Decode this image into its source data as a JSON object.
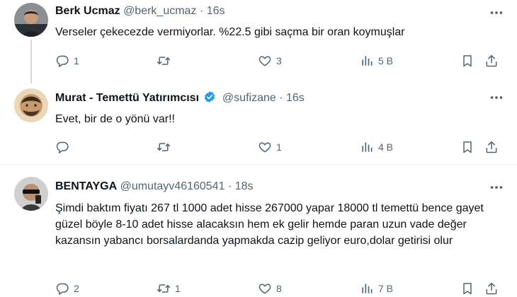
{
  "tweets": [
    {
      "name": "Berk Ucmaz",
      "handle": "@berk_ucmaz",
      "sep": "·",
      "time": "16s",
      "text": "Verseler çekecezde vermiyorlar. %22.5 gibi saçma bir oran koymuşlar",
      "replies": "1",
      "retweets": "",
      "likes": "3",
      "views": "5 B"
    },
    {
      "name": "Murat - Temettü Yatırımcısı",
      "handle": "@sufizane",
      "sep": "·",
      "time": "16s",
      "text": "Evet, bir de o yönü var!!",
      "replies": "",
      "retweets": "",
      "likes": "1",
      "views": "4 B"
    },
    {
      "name": "BENTAYGA",
      "handle": "@umutayv46160541",
      "sep": "·",
      "time": "18s",
      "text": "Şimdi baktım fiyatı 267 tl 1000 adet hisse 267000 yapar 18000 tl temettü bence gayet güzel böyle 8-10 adet hisse alacaksın hem ek gelir hemde paran uzun vade değer kazansın yabancı borsalardanda yapmakda cazip geliyor euro,dolar getirisi olur",
      "replies": "2",
      "retweets": "1",
      "likes": "8",
      "views": "7 B"
    }
  ],
  "colors": {
    "text": "#0f1419",
    "muted": "#536471",
    "verified": "#1d9bf0",
    "divider": "#eff3f4"
  }
}
